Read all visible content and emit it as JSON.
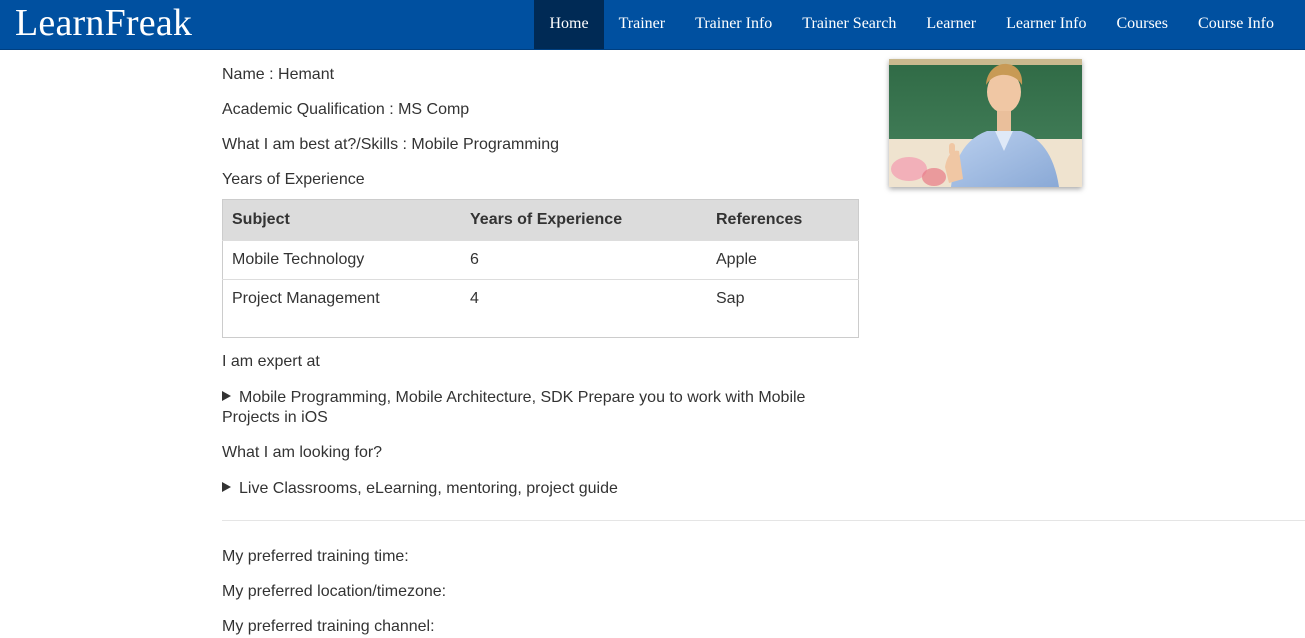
{
  "brand": "LearnFreak",
  "nav": [
    {
      "label": "Home",
      "active": true
    },
    {
      "label": "Trainer"
    },
    {
      "label": "Trainer Info"
    },
    {
      "label": "Trainer Search"
    },
    {
      "label": "Learner"
    },
    {
      "label": "Learner Info"
    },
    {
      "label": "Courses"
    },
    {
      "label": "Course Info"
    }
  ],
  "profile": {
    "name": "Name : Hemant",
    "qualification": "Academic Qualification : MS Comp",
    "skills": "What I am best at?/Skills : Mobile Programming",
    "experience_heading": "Years of Experience"
  },
  "experience_table": {
    "headers": [
      "Subject",
      "Years of Experience",
      "References"
    ],
    "rows": [
      [
        "Mobile Technology",
        "6",
        "Apple"
      ],
      [
        "Project Management",
        "4",
        "Sap"
      ]
    ]
  },
  "expert": {
    "heading": "I am expert at",
    "item": "Mobile Programming, Mobile Architecture, SDK Prepare you to work with Mobile Projects in iOS"
  },
  "looking": {
    "heading": "What I am looking for?",
    "item": "Live Classrooms, eLearning, mentoring, project guide"
  },
  "preferences": {
    "time": "My preferred training time:",
    "location": "My preferred location/timezone:",
    "channel": "My preferred training channel:"
  }
}
